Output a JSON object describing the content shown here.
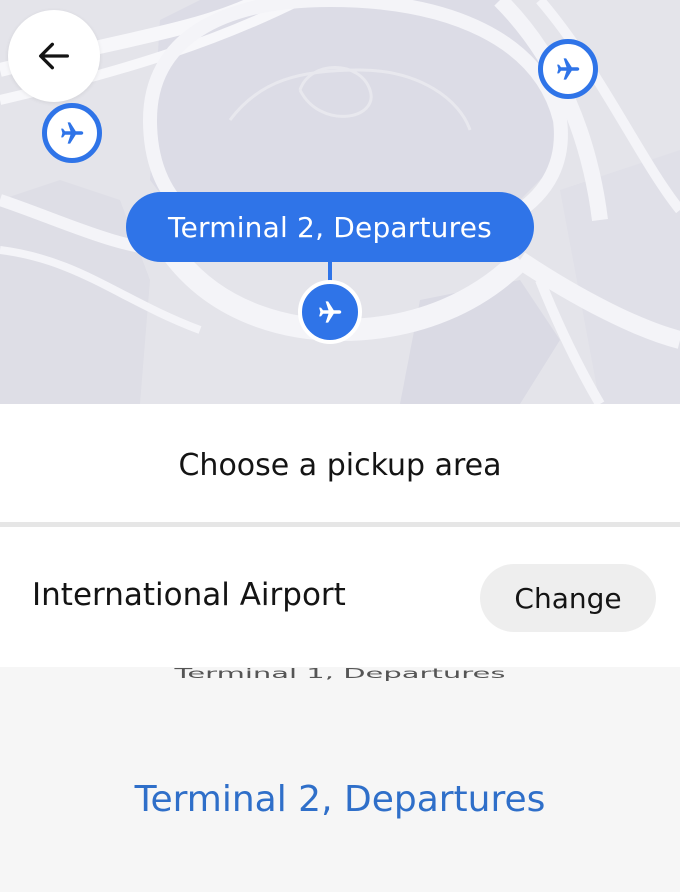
{
  "map": {
    "selected_terminal_label": "Terminal 2, Departures",
    "pin_icon": "airplane-icon",
    "back_icon": "arrow-left-icon",
    "accent_color": "#2f74e8"
  },
  "sheet": {
    "title": "Choose a pickup area",
    "location_name": "International Airport",
    "change_label": "Change"
  },
  "picker": {
    "options": [
      "Terminal 1, Departures",
      "Terminal 2, Departures"
    ],
    "selected": "Terminal 2, Departures",
    "selected_color": "#2f6fc9"
  }
}
